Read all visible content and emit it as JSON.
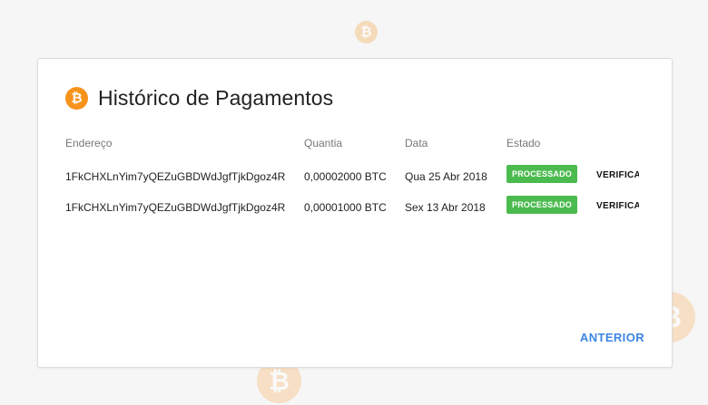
{
  "background": {
    "coin_symbol": "₿",
    "coin_color": "#f7c58c"
  },
  "modal": {
    "title": "Histórico de Pagamentos",
    "title_icon": "bitcoin-icon",
    "title_icon_symbol": "₿",
    "accent": "#f7931a",
    "table": {
      "headers": {
        "address": "Endereço",
        "amount": "Quantia",
        "date": "Data",
        "state": "Estado"
      },
      "rows": [
        {
          "address": "1FkCHXLnYim7yQEZuGBDWdJgfTjkDgoz4R",
          "amount": "0,00002000 BTC",
          "date": "Qua 25 Abr 2018",
          "state": "PROCESSADO",
          "action": "VERIFICA"
        },
        {
          "address": "1FkCHXLnYim7yQEZuGBDWdJgfTjkDgoz4R",
          "amount": "0,00001000 BTC",
          "date": "Sex 13 Abr 2018",
          "state": "PROCESSADO",
          "action": "VERIFICA"
        }
      ]
    },
    "previous_button": "ANTERIOR",
    "status_color": "#4cbb4f",
    "link_color": "#3b86e3"
  }
}
